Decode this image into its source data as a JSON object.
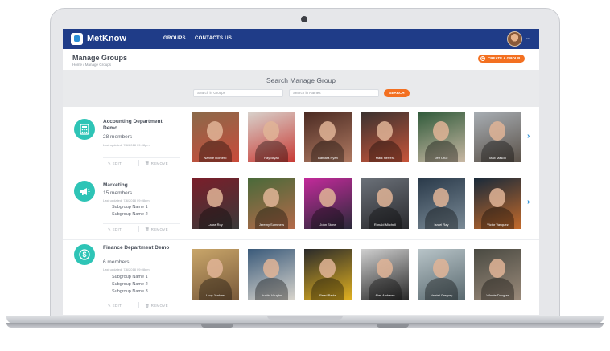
{
  "app": {
    "brand": "MetKnow",
    "nav": [
      "GROUPS",
      "CONTACTS US"
    ]
  },
  "header": {
    "title": "Manage Groups",
    "breadcrumb": "Home  /  Manage Groups",
    "create_label": "CREATE A GROUP"
  },
  "search": {
    "title": "Search Manage Group",
    "groups_placeholder": "Search in Groups",
    "names_placeholder": "Search in Names",
    "button": "SEARCH"
  },
  "actions": {
    "edit": "EDIT",
    "remove": "REMOVE"
  },
  "groups": [
    {
      "name": "Accounting Department Demo",
      "members": "28 members",
      "updated": "Last updated: 7/6/2018 09:08pm",
      "subgroups": [],
      "icon": "calculator-icon",
      "people": [
        {
          "name": "Nannie Romero",
          "colors": [
            "#8a6a4a",
            "#c94a3a"
          ]
        },
        {
          "name": "Ray Bryan",
          "colors": [
            "#d8d2cc",
            "#c83a34"
          ]
        },
        {
          "name": "Barbara Ryan",
          "colors": [
            "#4a2a22",
            "#b07a62"
          ]
        },
        {
          "name": "Mark Herrera",
          "colors": [
            "#3a3230",
            "#c8553a"
          ]
        },
        {
          "name": "Jeff Cruz",
          "colors": [
            "#2f5a3a",
            "#c9b8a4"
          ]
        },
        {
          "name": "Max Mason",
          "colors": [
            "#a8aeb4",
            "#5a5148"
          ]
        }
      ]
    },
    {
      "name": "Marketing",
      "members": "15 members",
      "updated": "Last updated: 7/6/2018 09:08pm",
      "subgroups": [
        "Subgroup Name 1",
        "Subgroup Name 2"
      ],
      "icon": "megaphone-icon",
      "people": [
        {
          "name": "Laura Roy",
          "colors": [
            "#7a1e2a",
            "#3a3a3a"
          ]
        },
        {
          "name": "Jeremy Summers",
          "colors": [
            "#4a6a3a",
            "#b46a4a"
          ]
        },
        {
          "name": "John Stone",
          "colors": [
            "#c22a9a",
            "#2a2a3a"
          ]
        },
        {
          "name": "Ronald Mitchell",
          "colors": [
            "#6a7078",
            "#2a2a2e"
          ]
        },
        {
          "name": "Israel Ray",
          "colors": [
            "#2a3a4a",
            "#7a8a96"
          ]
        },
        {
          "name": "Victor Vasquez",
          "colors": [
            "#1a2a3a",
            "#c46a2a"
          ]
        }
      ]
    },
    {
      "name": "Finance Department Demo",
      "members": "6 members",
      "updated": "Last updated: 7/6/2018 09:08pm",
      "subgroups": [
        "Subgroup Name 1",
        "Subgroup Name 2",
        "Subgroup Name 3"
      ],
      "icon": "dollar-icon",
      "people": [
        {
          "name": "Lucy Jenkins",
          "colors": [
            "#c9a66a",
            "#7a5a3a"
          ]
        },
        {
          "name": "Austin Vaughn",
          "colors": [
            "#3a5a7a",
            "#d8d4cc"
          ]
        },
        {
          "name": "Pearl Parks",
          "colors": [
            "#2a2a2a",
            "#e0b020"
          ]
        },
        {
          "name": "Alan Andrews",
          "colors": [
            "#cfcfcf",
            "#2a2a2a"
          ]
        },
        {
          "name": "Harriet Gregory",
          "colors": [
            "#b8c4c8",
            "#5a6a70"
          ]
        },
        {
          "name": "Winnie Douglas",
          "colors": [
            "#4a4a42",
            "#9a8a7a"
          ]
        }
      ]
    }
  ]
}
